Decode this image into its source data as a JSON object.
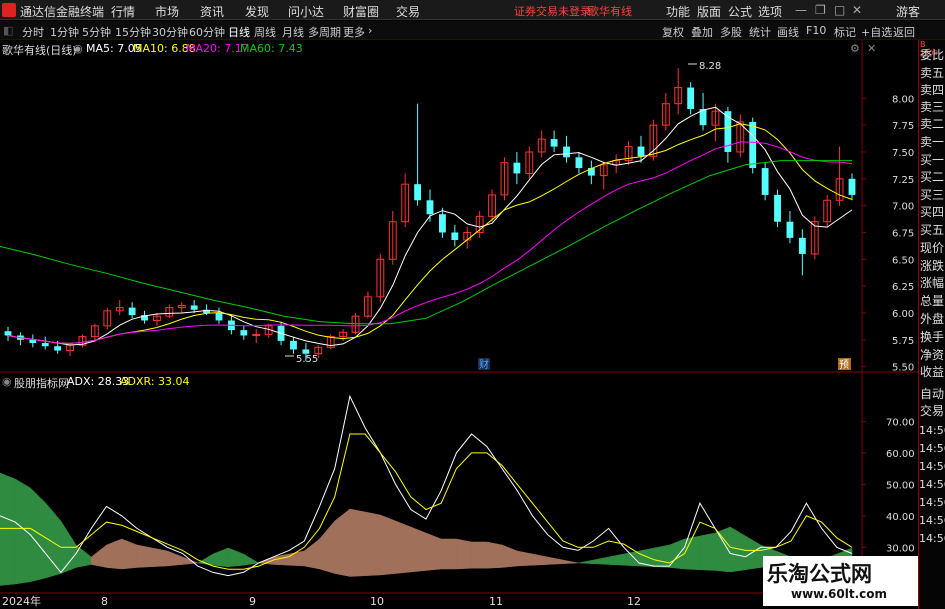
{
  "app": {
    "name": "通达信金融终端",
    "status": "证券交易未登录",
    "stock_name": "歌华有线",
    "guest": "游客"
  },
  "menu": [
    "行情",
    "市场",
    "资讯",
    "发现",
    "问小达",
    "财富圈",
    "交易"
  ],
  "menu_right": [
    "功能",
    "版面",
    "公式",
    "选项"
  ],
  "toolbar": {
    "periods": [
      "分时",
      "1分钟",
      "5分钟",
      "15分钟",
      "30分钟",
      "60分钟",
      "日线",
      "周线",
      "月线",
      "多周期",
      "更多"
    ],
    "active": "日线",
    "right": [
      "复权",
      "叠加",
      "多股",
      "统计",
      "画线",
      "F10",
      "标记",
      "+自选",
      "返回"
    ]
  },
  "main_legend": {
    "title": "歌华有线(日线)",
    "ma5": "MA5: 7.05",
    "ma10": "MA10: 6.88",
    "ma20": "MA20: 7.17",
    "ma60": "MA60: 7.43"
  },
  "indicator_legend": {
    "title": "股朋指标网",
    "adx": "ADX: 28.33",
    "adxr": "ADXR: 33.04"
  },
  "price_axis": [
    "8.00",
    "7.75",
    "7.50",
    "7.25",
    "7.00",
    "6.75",
    "6.50",
    "6.25",
    "6.00",
    "5.75",
    "5.50"
  ],
  "ind_axis": [
    "70.00",
    "60.00",
    "50.00",
    "40.00",
    "30.00"
  ],
  "annotations": {
    "high": "8.28",
    "low": "5.55",
    "badge_cai": "财",
    "badge_yu": "预"
  },
  "date_axis": [
    "2024年",
    "8",
    "9",
    "10",
    "11",
    "12"
  ],
  "sidebar": [
    "委比",
    "卖五",
    "卖四",
    "卖三",
    "卖二",
    "卖一",
    "买一",
    "买二",
    "买三",
    "买四",
    "买五",
    "现价",
    "涨跌",
    "涨幅",
    "总量",
    "外盘",
    "换手",
    "净资",
    "收益"
  ],
  "sidebar_lower": [
    "自动",
    "交易"
  ],
  "sidebar_times": [
    "14:56",
    "14:56",
    "14:56",
    "14:56",
    "14:56",
    "14:56",
    "14:56"
  ],
  "sidebar_top": [
    "B",
    "1000"
  ],
  "watermark": {
    "main": "乐淘公式网",
    "url": "www.60lt.com"
  },
  "colors": {
    "up": "#ff3232",
    "down": "#54ffff",
    "ma5": "#ffffff",
    "ma10": "#ffff00",
    "ma20": "#ff00ff",
    "ma60": "#00cc00",
    "fill_up": "#a0705a",
    "fill_down": "#2e8b40"
  },
  "chart_data": [
    {
      "type": "candlestick",
      "title": "歌华有线(日线)",
      "y_range": [
        5.45,
        8.45
      ],
      "ohlc": [
        [
          5.83,
          5.87,
          5.74,
          5.79
        ],
        [
          5.79,
          5.82,
          5.7,
          5.75
        ],
        [
          5.75,
          5.8,
          5.68,
          5.72
        ],
        [
          5.72,
          5.78,
          5.66,
          5.69
        ],
        [
          5.69,
          5.74,
          5.62,
          5.65
        ],
        [
          5.65,
          5.72,
          5.6,
          5.7
        ],
        [
          5.7,
          5.8,
          5.68,
          5.78
        ],
        [
          5.78,
          5.9,
          5.75,
          5.88
        ],
        [
          5.88,
          6.05,
          5.85,
          6.02
        ],
        [
          6.02,
          6.12,
          5.98,
          6.05
        ],
        [
          6.05,
          6.1,
          5.95,
          5.98
        ],
        [
          5.98,
          6.02,
          5.9,
          5.93
        ],
        [
          5.93,
          6.0,
          5.88,
          5.97
        ],
        [
          5.97,
          6.08,
          5.95,
          6.05
        ],
        [
          6.05,
          6.1,
          6.0,
          6.07
        ],
        [
          6.07,
          6.12,
          6.0,
          6.03
        ],
        [
          6.03,
          6.08,
          5.98,
          6.0
        ],
        [
          6.0,
          6.05,
          5.9,
          5.93
        ],
        [
          5.93,
          5.98,
          5.8,
          5.84
        ],
        [
          5.84,
          5.88,
          5.75,
          5.79
        ],
        [
          5.79,
          5.85,
          5.72,
          5.8
        ],
        [
          5.8,
          5.9,
          5.77,
          5.88
        ],
        [
          5.88,
          5.92,
          5.7,
          5.74
        ],
        [
          5.74,
          5.78,
          5.62,
          5.66
        ],
        [
          5.66,
          5.72,
          5.55,
          5.62
        ],
        [
          5.62,
          5.7,
          5.58,
          5.68
        ],
        [
          5.68,
          5.8,
          5.66,
          5.78
        ],
        [
          5.78,
          5.85,
          5.74,
          5.82
        ],
        [
          5.82,
          6.0,
          5.8,
          5.97
        ],
        [
          5.97,
          6.2,
          5.95,
          6.15
        ],
        [
          6.15,
          6.55,
          6.1,
          6.5
        ],
        [
          6.5,
          6.95,
          6.45,
          6.85
        ],
        [
          6.85,
          7.3,
          6.8,
          7.2
        ],
        [
          7.2,
          7.95,
          7.0,
          7.05
        ],
        [
          7.05,
          7.15,
          6.85,
          6.92
        ],
        [
          6.92,
          6.98,
          6.7,
          6.75
        ],
        [
          6.75,
          6.82,
          6.62,
          6.68
        ],
        [
          6.68,
          6.8,
          6.6,
          6.75
        ],
        [
          6.75,
          6.95,
          6.7,
          6.9
        ],
        [
          6.9,
          7.15,
          6.85,
          7.1
        ],
        [
          7.1,
          7.45,
          7.05,
          7.4
        ],
        [
          7.4,
          7.5,
          7.2,
          7.3
        ],
        [
          7.3,
          7.55,
          7.25,
          7.5
        ],
        [
          7.5,
          7.7,
          7.45,
          7.62
        ],
        [
          7.62,
          7.7,
          7.5,
          7.55
        ],
        [
          7.55,
          7.65,
          7.4,
          7.45
        ],
        [
          7.45,
          7.5,
          7.3,
          7.35
        ],
        [
          7.35,
          7.42,
          7.2,
          7.28
        ],
        [
          7.28,
          7.4,
          7.15,
          7.38
        ],
        [
          7.38,
          7.48,
          7.3,
          7.42
        ],
        [
          7.42,
          7.6,
          7.38,
          7.55
        ],
        [
          7.55,
          7.65,
          7.4,
          7.46
        ],
        [
          7.46,
          7.8,
          7.42,
          7.75
        ],
        [
          7.75,
          8.05,
          7.7,
          7.95
        ],
        [
          7.95,
          8.28,
          7.85,
          8.1
        ],
        [
          8.1,
          8.15,
          7.85,
          7.9
        ],
        [
          7.9,
          8.05,
          7.7,
          7.75
        ],
        [
          7.75,
          7.95,
          7.6,
          7.88
        ],
        [
          7.88,
          7.92,
          7.4,
          7.5
        ],
        [
          7.5,
          7.85,
          7.45,
          7.78
        ],
        [
          7.78,
          7.82,
          7.3,
          7.35
        ],
        [
          7.35,
          7.4,
          7.05,
          7.1
        ],
        [
          7.1,
          7.15,
          6.8,
          6.85
        ],
        [
          6.85,
          6.95,
          6.65,
          6.7
        ],
        [
          6.7,
          6.78,
          6.35,
          6.55
        ],
        [
          6.55,
          6.9,
          6.5,
          6.85
        ],
        [
          6.85,
          7.1,
          6.8,
          7.05
        ],
        [
          7.05,
          7.55,
          7.0,
          7.25
        ],
        [
          7.25,
          7.3,
          7.05,
          7.1
        ]
      ],
      "ma60": [
        6.62,
        6.54,
        6.45,
        6.37,
        6.28,
        6.2,
        6.12,
        6.05,
        5.97,
        5.92,
        5.9,
        5.9,
        5.95,
        6.1,
        6.28,
        6.45,
        6.62,
        6.8,
        6.97,
        7.13,
        7.28,
        7.38,
        7.42,
        7.42,
        7.42
      ]
    },
    {
      "type": "area",
      "title": "股朋指标网",
      "y_range": [
        18,
        80
      ],
      "adx": [
        40,
        38,
        34,
        28,
        22,
        28,
        36,
        43,
        40,
        36,
        33,
        30,
        28,
        24,
        22,
        21,
        22,
        25,
        27,
        29,
        32,
        43,
        55,
        78,
        68,
        60,
        50,
        42,
        39,
        48,
        60,
        66,
        62,
        55,
        48,
        40,
        34,
        30,
        29,
        32,
        36,
        30,
        25,
        24,
        24,
        30,
        44,
        36,
        28,
        27,
        30,
        30,
        35,
        44,
        36,
        30,
        28
      ],
      "adxr": [
        36,
        36,
        36,
        33,
        30,
        30,
        34,
        38,
        37,
        35,
        33,
        31,
        29,
        26,
        24,
        23,
        23,
        24,
        26,
        27,
        30,
        36,
        46,
        66,
        66,
        60,
        54,
        46,
        42,
        44,
        55,
        60,
        60,
        56,
        50,
        44,
        38,
        32,
        30,
        30,
        32,
        31,
        28,
        26,
        25,
        28,
        38,
        36,
        30,
        29,
        29,
        30,
        32,
        40,
        38,
        33,
        30
      ],
      "diff": [
        -30,
        -28,
        -25,
        -20,
        -14,
        -6,
        2,
        6,
        8,
        6,
        5,
        4,
        2,
        0,
        -3,
        -5,
        -3,
        0,
        2,
        3,
        4,
        8,
        14,
        18,
        17,
        16,
        14,
        12,
        10,
        8,
        8,
        7,
        7,
        6,
        4,
        3,
        2,
        1,
        0,
        -1,
        -2,
        -3,
        -4,
        -5,
        -6,
        -8,
        -9,
        -10,
        -12,
        -9,
        -6,
        -4,
        -2,
        0,
        -1,
        -3,
        -5
      ]
    }
  ]
}
